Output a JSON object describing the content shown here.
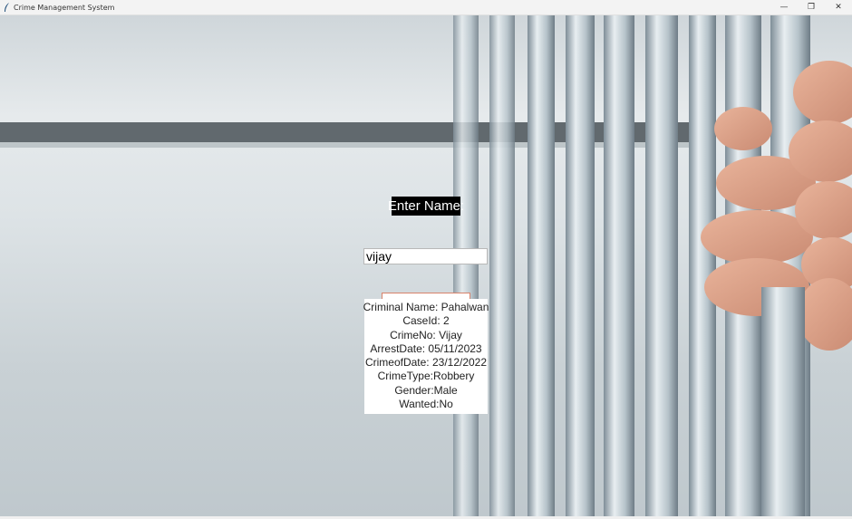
{
  "window": {
    "title": "Crime Management System",
    "minimize_icon": "—",
    "maximize_icon": "❐",
    "close_icon": "✕"
  },
  "form": {
    "name_label": "Enter Name:",
    "name_value": "vijay"
  },
  "result": {
    "lines": [
      "Criminal Name: Pahalwan",
      "CaseId: 2",
      "CrimeNo: Vijay",
      "ArrestDate: 05/11/2023",
      "CrimeofDate: 23/12/2022",
      "CrimeType:Robbery",
      "Gender:Male",
      "Wanted:No"
    ]
  },
  "colors": {
    "label_bg": "#000000",
    "button_border": "#d8836b"
  }
}
